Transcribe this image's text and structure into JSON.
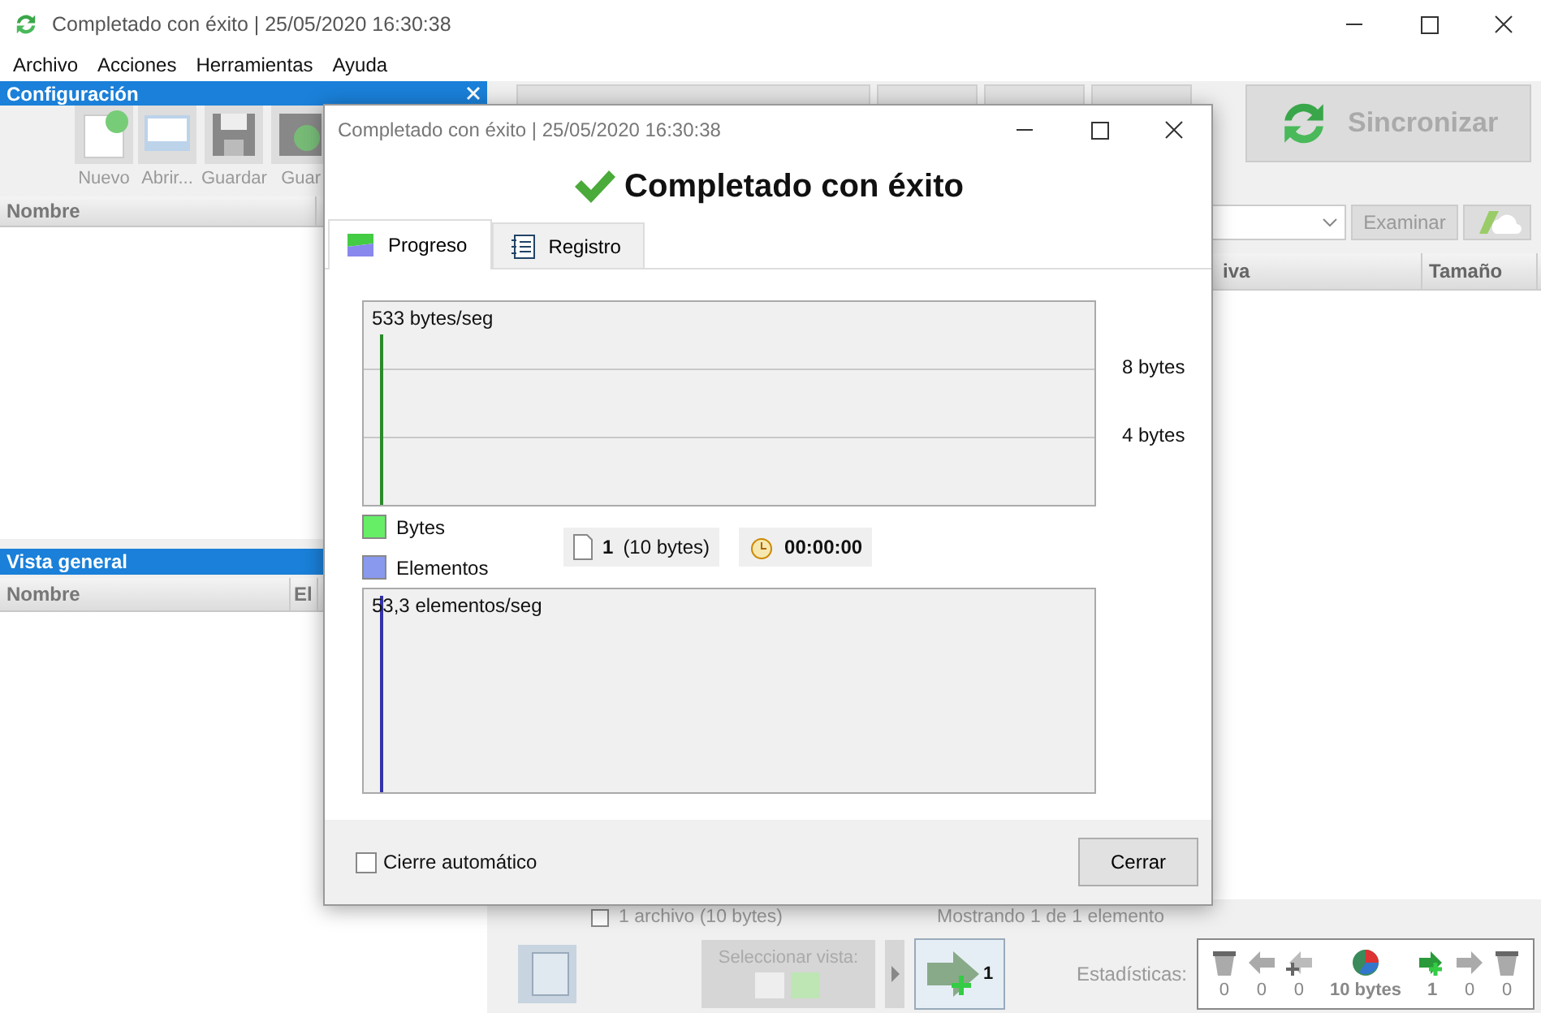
{
  "window": {
    "title": "Completado con éxito | 25/05/2020 16:30:38"
  },
  "menu": [
    "Archivo",
    "Acciones",
    "Herramientas",
    "Ayuda"
  ],
  "config_panel": {
    "title": "Configuración",
    "tools": [
      {
        "kind": "new",
        "label": "Nuevo"
      },
      {
        "kind": "open",
        "label": "Abrir..."
      },
      {
        "kind": "save",
        "label": "Guardar"
      },
      {
        "kind": "saveas",
        "label": "Guar"
      }
    ],
    "columns": [
      "Nombre"
    ]
  },
  "overview_panel": {
    "title": "Vista general",
    "columns": [
      "Nombre",
      "El"
    ]
  },
  "sync_button": "Sincronizar",
  "browse_button": "Examinar",
  "file_list": {
    "columns": [
      "iva",
      "Tamaño"
    ]
  },
  "status": {
    "selection": {
      "label": "1 archivo (10 bytes)",
      "checked": false
    },
    "count": "Mostrando 1 de 1 elemento"
  },
  "bottom_bar": {
    "view_selector": "Seleccionar vista:",
    "add_count": "1",
    "stats_label": "Estadísticas:",
    "stats": [
      {
        "kind": "delete-left",
        "value": "0",
        "highlighted": false
      },
      {
        "kind": "left",
        "value": "0",
        "highlighted": false
      },
      {
        "kind": "add-left",
        "value": "0",
        "highlighted": false
      },
      {
        "kind": "pie",
        "value": "10 bytes",
        "highlighted": true
      },
      {
        "kind": "add-right",
        "value": "1",
        "highlighted": true
      },
      {
        "kind": "right",
        "value": "0",
        "highlighted": false
      },
      {
        "kind": "delete-right",
        "value": "0",
        "highlighted": false
      }
    ]
  },
  "dialog": {
    "title": "Completado con éxito | 25/05/2020 16:30:38",
    "heading": "Completado con éxito",
    "tabs": [
      {
        "kind": "progress",
        "label": "Progreso",
        "selected": true
      },
      {
        "kind": "log",
        "label": "Registro",
        "selected": false
      }
    ],
    "bytes_chart": {
      "rate": "533 bytes/seg",
      "ticks": [
        "8 bytes",
        "4 bytes"
      ]
    },
    "legend": [
      {
        "label": "Bytes",
        "color": "#66ee66"
      },
      {
        "label": "Elementos",
        "color": "#8899ee"
      }
    ],
    "file_count": "1",
    "file_size": "(10 bytes)",
    "elapsed": "00:00:00",
    "items_chart": {
      "rate": "53,3 elementos/seg"
    },
    "auto_close": {
      "label": "Cierre automático",
      "checked": false
    },
    "close_button": "Cerrar"
  }
}
